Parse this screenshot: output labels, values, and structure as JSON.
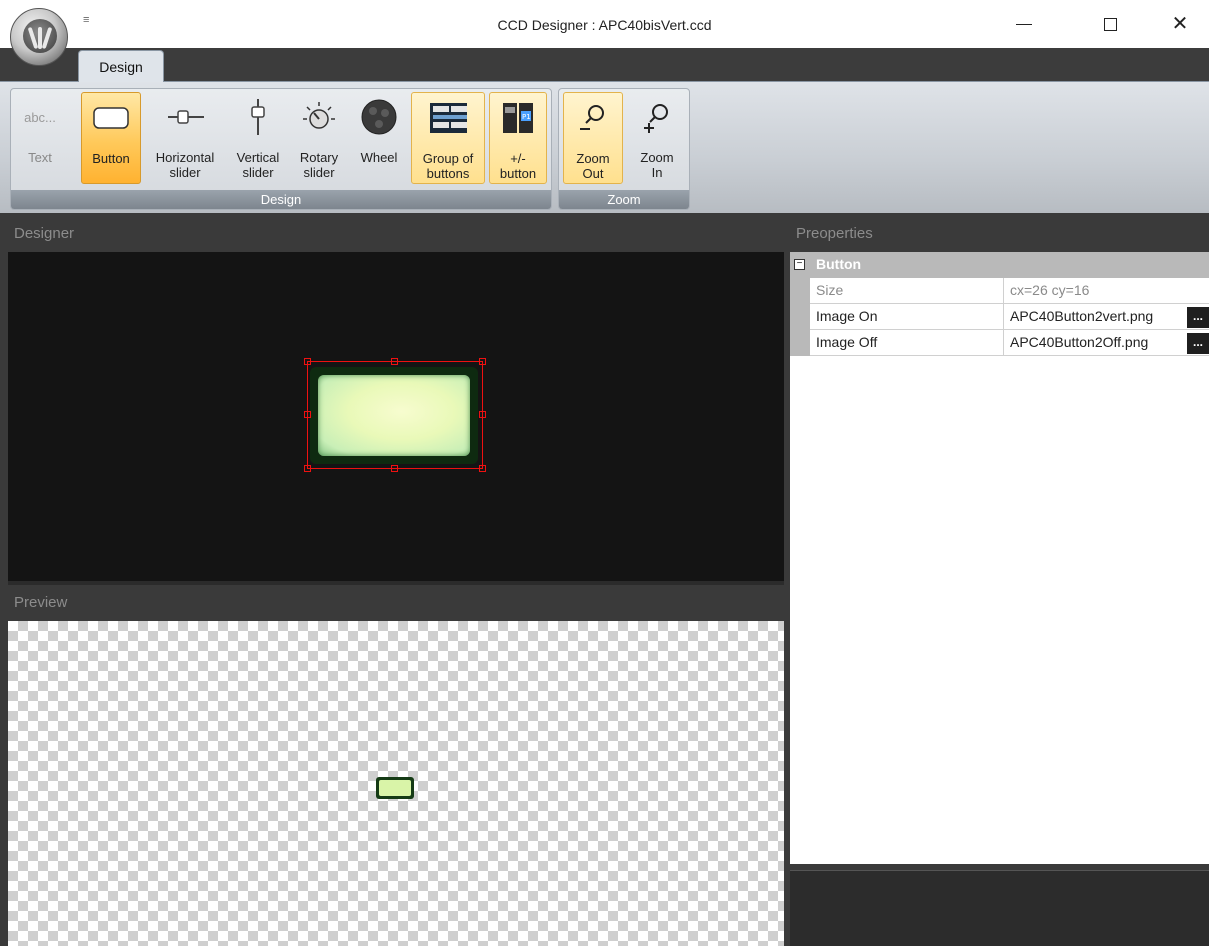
{
  "window": {
    "title": "CCD Designer : APC40bisVert.ccd",
    "qat_arrow": "≡"
  },
  "ribbon": {
    "active_tab": "Design",
    "groups": {
      "design": {
        "label": "Design",
        "buttons": [
          {
            "id": "text",
            "label": "Text",
            "icon": "text-icon",
            "state": "disabled"
          },
          {
            "id": "button",
            "label": "Button",
            "icon": "button-shape-icon",
            "state": "active"
          },
          {
            "id": "horizontal-slider",
            "label": "Horizontal\nslider",
            "icon": "horizontal-slider-icon",
            "state": "normal"
          },
          {
            "id": "vertical-slider",
            "label": "Vertical\nslider",
            "icon": "vertical-slider-icon",
            "state": "normal"
          },
          {
            "id": "rotary-slider",
            "label": "Rotary\nslider",
            "icon": "rotary-knob-icon",
            "state": "normal"
          },
          {
            "id": "wheel",
            "label": "Wheel",
            "icon": "wheel-icon",
            "state": "normal"
          },
          {
            "id": "group-of-buttons",
            "label": "Group of\nbuttons",
            "icon": "button-group-icon",
            "state": "hover"
          },
          {
            "id": "plus-minus-button",
            "label": "+/-\nbutton",
            "icon": "plus-minus-button-icon",
            "state": "hover"
          }
        ]
      },
      "zoom": {
        "label": "Zoom",
        "buttons": [
          {
            "id": "zoom-out",
            "label": "Zoom\nOut",
            "icon": "zoom-out-icon",
            "state": "hover"
          },
          {
            "id": "zoom-in",
            "label": "Zoom\nIn",
            "icon": "zoom-in-icon",
            "state": "normal"
          }
        ]
      }
    }
  },
  "panels": {
    "designer_title": "Designer",
    "preview_title": "Preview",
    "properties_title": "Preoperties"
  },
  "properties": {
    "category": "Button",
    "category_toggle": "−",
    "rows": [
      {
        "name": "Size",
        "value": "cx=26 cy=16",
        "readonly": true
      },
      {
        "name": "Image On",
        "value": "APC40Button2vert.png",
        "readonly": false,
        "ellipsis": "..."
      },
      {
        "name": "Image Off",
        "value": "APC40Button2Off.png",
        "readonly": false,
        "ellipsis": "..."
      }
    ]
  },
  "colors": {
    "frame": "#3a3a3a",
    "canvas": "#141414",
    "selection": "#ee1111",
    "ribbon_active": "#ffc95a",
    "button_face": "#e9f9b8"
  }
}
